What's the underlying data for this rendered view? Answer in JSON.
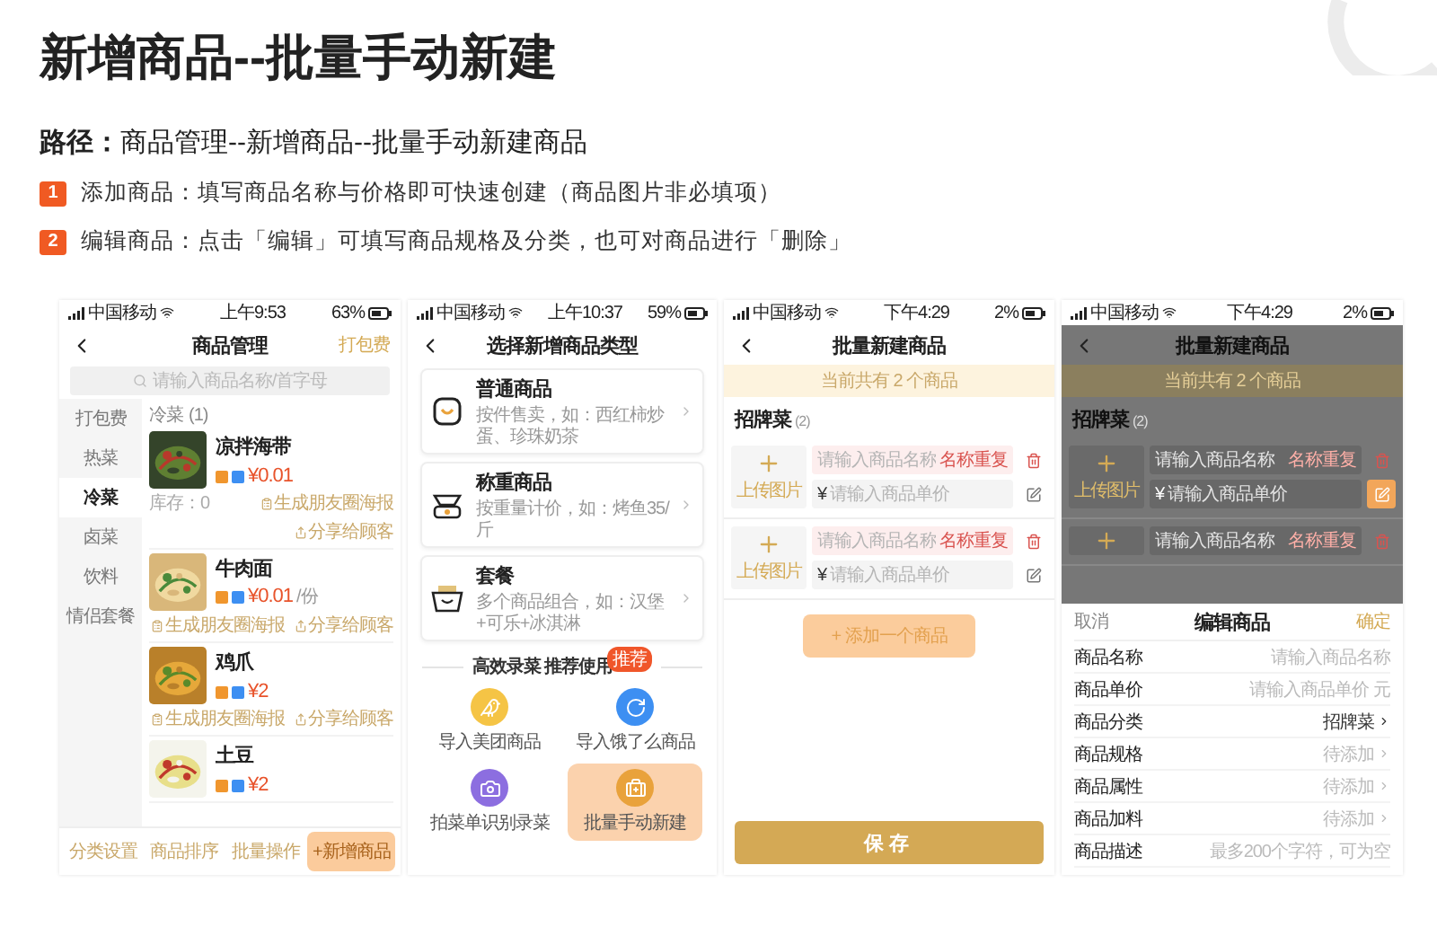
{
  "title": "新增商品--批量手动新建",
  "path": "**路径：**商品管理--新增商品--批量手动新建商品",
  "steps": [
    {
      "number": "1",
      "text": "添加商品：填写商品名称与价格即可快速创建（商品图片非必填项）"
    },
    {
      "number": "2",
      "text": "编辑商品：点击「编辑」可填写商品规格及分类，也可对商品进行「删除」"
    }
  ],
  "phones": [
    {
      "kind": "product_list",
      "status_bar": {
        "carrier": "中国移动",
        "time": "上午9:53",
        "battery": "63%"
      },
      "nav": {
        "title": "商品管理",
        "action": "打包费"
      },
      "search": {
        "placeholder": "请输入商品名称/首字母"
      },
      "categories": [
        {
          "label": "打包费",
          "selected": false
        },
        {
          "label": "热菜",
          "selected": false
        },
        {
          "label": "冷菜",
          "selected": true
        },
        {
          "label": "卤菜",
          "selected": false
        },
        {
          "label": "饮料",
          "selected": false
        },
        {
          "label": "情侣套餐",
          "selected": false
        }
      ],
      "section": {
        "title": "冷菜",
        "count": "(1)"
      },
      "items": [
        {
          "name": "凉拌海带",
          "price": "¥0.01",
          "stock": "库存：0",
          "actions": [
            "生成朋友圈海报",
            "分享给顾客"
          ]
        },
        {
          "name": "牛肉面",
          "price": "¥0.01",
          "unit": "/份",
          "actions": [
            "生成朋友圈海报",
            "分享给顾客"
          ]
        },
        {
          "name": "鸡爪",
          "price": "¥2",
          "actions": [
            "生成朋友圈海报",
            "分享给顾客"
          ]
        },
        {
          "name": "土豆",
          "price": "¥2"
        }
      ],
      "bottom_tabs": [
        {
          "label": "分类设置",
          "highlighted": false
        },
        {
          "label": "商品排序",
          "highlighted": false
        },
        {
          "label": "批量操作",
          "highlighted": false
        },
        {
          "label": "+新增商品",
          "highlighted": true
        }
      ]
    },
    {
      "kind": "type_picker",
      "status_bar": {
        "carrier": "中国移动",
        "time": "上午10:37",
        "battery": "59%"
      },
      "nav": {
        "title": "选择新增商品类型"
      },
      "types": [
        {
          "name": "普通商品",
          "description": "按件售卖，如：西红柿炒蛋、珍珠奶茶"
        },
        {
          "name": "称重商品",
          "description": "按重量计价，如：烤鱼35/斤"
        },
        {
          "name": "套餐",
          "description": "多个商品组合，如：汉堡+可乐+冰淇淋"
        }
      ],
      "divider": {
        "label": "高效录菜 推荐使用",
        "badge": "推荐"
      },
      "tools": [
        {
          "label": "导入美团商品",
          "color": "#f5c445",
          "highlighted": false
        },
        {
          "label": "导入饿了么商品",
          "color": "#3d8ff2",
          "highlighted": false
        },
        {
          "label": "拍菜单识别录菜",
          "color": "#8c6ee0",
          "highlighted": false
        },
        {
          "label": "批量手动新建",
          "color": "#e9a23b",
          "highlighted": true
        }
      ]
    },
    {
      "kind": "batch_create",
      "status_bar": {
        "carrier": "中国移动",
        "time": "下午4:29",
        "battery": "2%"
      },
      "nav": {
        "title": "批量新建商品"
      },
      "banner": "当前共有 2 个商品",
      "group": {
        "title": "招牌菜",
        "count": "(2)"
      },
      "rows": [
        {
          "upload": "上传图片",
          "name_placeholder": "请输入商品名称",
          "warning": "名称重复",
          "currency": "¥",
          "price_placeholder": "请输入商品单价",
          "edit_highlighted": false
        },
        {
          "upload": "上传图片",
          "name_placeholder": "请输入商品名称",
          "warning": "名称重复",
          "currency": "¥",
          "price_placeholder": "请输入商品单价",
          "edit_highlighted": false
        }
      ],
      "add_button": {
        "label": "+ 添加一个商品",
        "highlighted": true
      },
      "save_button": "保存"
    },
    {
      "kind": "batch_edit",
      "status_bar": {
        "carrier": "中国移动",
        "time": "下午4:29",
        "battery": "2%"
      },
      "nav": {
        "title": "批量新建商品"
      },
      "banner": "当前共有 2 个商品",
      "group": {
        "title": "招牌菜",
        "count": "(2)"
      },
      "rows": [
        {
          "upload": "上传图片",
          "name_placeholder": "请输入商品名称",
          "warning": "名称重复",
          "currency": "¥",
          "price_placeholder": "请输入商品单价",
          "edit_highlighted": true
        },
        {
          "name_placeholder": "请输入商品名称",
          "warning": "名称重复"
        }
      ],
      "sheet": {
        "cancel": "取消",
        "title": "编辑商品",
        "confirm": "确定",
        "fields": [
          {
            "label": "商品名称",
            "placeholder": "请输入商品名称",
            "arrow": false
          },
          {
            "label": "商品单价",
            "placeholder": "请输入商品单价 元",
            "arrow": false
          },
          {
            "label": "商品分类",
            "value": "招牌菜",
            "arrow": true
          },
          {
            "label": "商品规格",
            "placeholder": "待添加",
            "arrow": true
          },
          {
            "label": "商品属性",
            "placeholder": "待添加",
            "arrow": true
          },
          {
            "label": "商品加料",
            "placeholder": "待添加",
            "arrow": true
          },
          {
            "label": "商品描述",
            "placeholder": "最多200个字符，可为空",
            "arrow": false
          }
        ]
      }
    }
  ]
}
